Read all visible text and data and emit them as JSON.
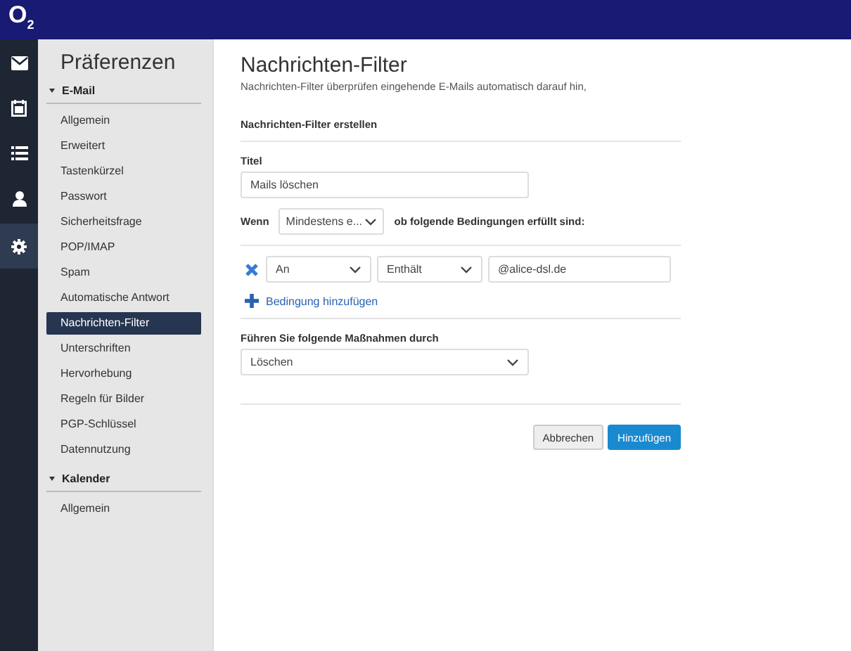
{
  "header": {
    "logo": "O$_{2}$"
  },
  "rail": [
    {
      "kind": "mail",
      "selected": false
    },
    {
      "kind": "calendar",
      "selected": false
    },
    {
      "kind": "list",
      "selected": false
    },
    {
      "kind": "contact",
      "selected": false
    },
    {
      "kind": "settings",
      "selected": true
    }
  ],
  "sidebar": {
    "title": "Präferenzen",
    "sections": [
      {
        "label": "E-Mail",
        "expanded": true,
        "items": [
          {
            "label": "Allgemein",
            "selected": false
          },
          {
            "label": "Erweitert",
            "selected": false
          },
          {
            "label": "Tastenkürzel",
            "selected": false
          },
          {
            "label": "Passwort",
            "selected": false
          },
          {
            "label": "Sicherheitsfrage",
            "selected": false
          },
          {
            "label": "POP/IMAP",
            "selected": false
          },
          {
            "label": "Spam",
            "selected": false
          },
          {
            "label": "Automatische Antwort",
            "selected": false
          },
          {
            "label": "Nachrichten-Filter",
            "selected": true
          },
          {
            "label": "Unterschriften",
            "selected": false
          },
          {
            "label": "Hervorhebung",
            "selected": false
          },
          {
            "label": "Regeln für Bilder",
            "selected": false
          },
          {
            "label": "PGP-Schlüssel",
            "selected": false
          },
          {
            "label": "Datennutzung",
            "selected": false
          }
        ]
      },
      {
        "label": "Kalender",
        "expanded": true,
        "items": [
          {
            "label": "Allgemein",
            "selected": false
          }
        ]
      }
    ]
  },
  "main": {
    "title": "Nachrichten-Filter",
    "subtitle": "Nachrichten-Filter überprüfen eingehende E-Mails automatisch darauf hin,",
    "section_title": "Nachrichten-Filter erstellen",
    "title_label": "Titel",
    "title_value": "Mails löschen",
    "when_label": "Wenn",
    "when_select": "Mindestens e...",
    "when_suffix": "ob folgende Bedingungen erfüllt sind:",
    "conditions": [
      {
        "field": "An",
        "operator": "Enthält",
        "value": "@alice-dsl.de"
      }
    ],
    "add_condition": "Bedingung hinzufügen",
    "action_label": "Führen Sie folgende Maßnahmen durch",
    "action_select": "Löschen",
    "buttons": [
      {
        "label": "Abbrechen",
        "kind": "secondary"
      },
      {
        "label": "Hinzufügen",
        "kind": "primary"
      }
    ]
  }
}
